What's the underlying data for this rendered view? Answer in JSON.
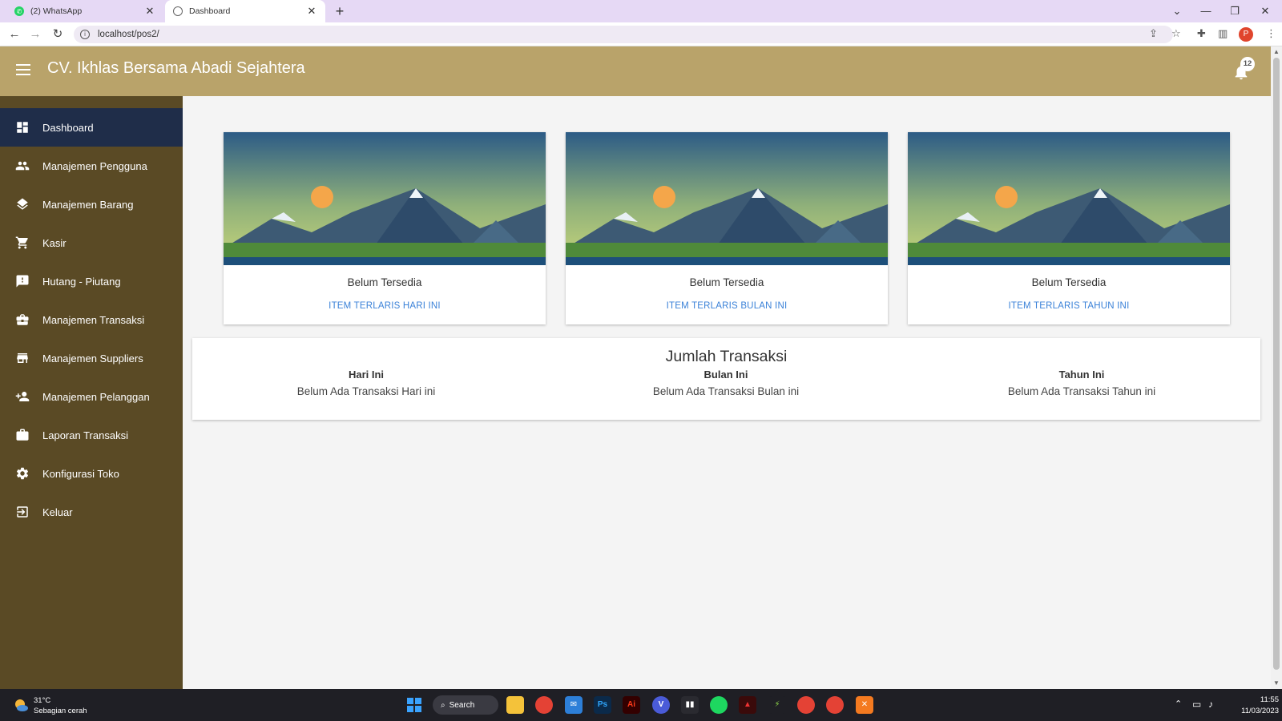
{
  "browser": {
    "tabs": [
      {
        "title": "(2) WhatsApp",
        "favicon": "whatsapp-icon",
        "active": false
      },
      {
        "title": "Dashboard",
        "favicon": "globe-icon",
        "active": true
      }
    ],
    "new_tab": "+",
    "close": "✕",
    "url": "localhost/pos2/"
  },
  "app": {
    "title": "CV. Ikhlas Bersama Abadi Sejahtera",
    "notification_count": "12",
    "header_color": "#b9a36a",
    "sidebar_color": "#5a4a25",
    "active_color": "#1f2d49",
    "link_color": "#3b82d8"
  },
  "sidebar": {
    "items": [
      {
        "label": "Dashboard",
        "icon": "dashboard-icon",
        "active": true
      },
      {
        "label": "Manajemen Pengguna",
        "icon": "users-icon"
      },
      {
        "label": "Manajemen Barang",
        "icon": "layers-icon"
      },
      {
        "label": "Kasir",
        "icon": "cart-icon"
      },
      {
        "label": "Hutang - Piutang",
        "icon": "alert-message-icon"
      },
      {
        "label": "Manajemen Transaksi",
        "icon": "briefcase-icon"
      },
      {
        "label": "Manajemen Suppliers",
        "icon": "store-icon"
      },
      {
        "label": "Manajemen Pelanggan",
        "icon": "add-person-icon"
      },
      {
        "label": "Laporan Transaksi",
        "icon": "work-icon"
      },
      {
        "label": "Konfigurasi Toko",
        "icon": "gear-icon"
      },
      {
        "label": "Keluar",
        "icon": "logout-icon"
      }
    ]
  },
  "cards": [
    {
      "text": "Belum Tersedia",
      "link": "ITEM TERLARIS HARI INI"
    },
    {
      "text": "Belum Tersedia",
      "link": "ITEM TERLARIS BULAN INI"
    },
    {
      "text": "Belum Tersedia",
      "link": "ITEM TERLARIS TAHUN INI"
    }
  ],
  "transactions": {
    "title": "Jumlah Transaksi",
    "columns": [
      {
        "heading": "Hari Ini",
        "value": "Belum Ada Transaksi Hari ini"
      },
      {
        "heading": "Bulan Ini",
        "value": "Belum Ada Transaksi Bulan ini"
      },
      {
        "heading": "Tahun Ini",
        "value": "Belum Ada Transaksi Tahun ini"
      }
    ]
  },
  "taskbar": {
    "weather_temp": "31°C",
    "weather_desc": "Sebagian cerah",
    "search_label": "Search",
    "time": "11:55",
    "date": "11/03/2023"
  }
}
